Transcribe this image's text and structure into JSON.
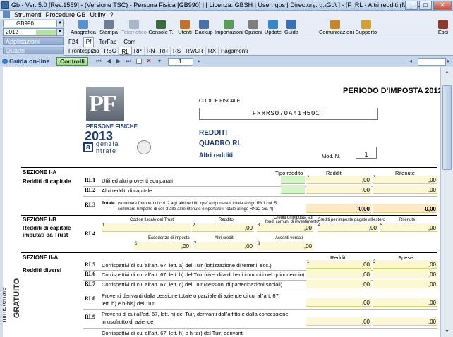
{
  "window": {
    "title": "Gb - Ver. 5.0 [Rev.1559] - (Versione TSC) - Persona Fisica [GB990]  | [ Licenza: GBSH | User: gbs | Directory: g:\\Gb\\ ] - [F_RL - Altri redditi (Mod.1)]",
    "minimize": "_",
    "maximize": "□",
    "close": "✕"
  },
  "menu": [
    "Strumenti",
    "Procedure GB",
    "Utility",
    "?"
  ],
  "left": {
    "module": "GB990",
    "year": "2012",
    "applicazioni": "Applicazioni",
    "quadri": "Quadri"
  },
  "toolbar": [
    {
      "label": "Anagrafica",
      "icon": "id-card-icon",
      "color": "#5a8fd0"
    },
    {
      "label": "Stampa",
      "icon": "printer-icon",
      "color": "#6c7d94"
    },
    {
      "label": "Telematico",
      "icon": "network-icon",
      "color": "#a9b6c8"
    },
    {
      "label": "Console T.",
      "icon": "console-icon",
      "color": "#3a6b3a"
    },
    {
      "label": "Utenti",
      "icon": "users-icon",
      "color": "#c0732f"
    },
    {
      "label": "Backup",
      "icon": "backup-icon",
      "color": "#4d6fa8"
    },
    {
      "label": "Importazioni",
      "icon": "import-icon",
      "color": "#5a9b58"
    },
    {
      "label": "Opzioni",
      "icon": "options-icon",
      "color": "#7e7e7e"
    },
    {
      "label": "Update",
      "icon": "update-icon",
      "color": "#3b87c4"
    },
    {
      "label": "Guida",
      "icon": "help-icon",
      "color": "#3c6fb5"
    },
    {
      "label": "Comunicazioni",
      "icon": "mail-icon",
      "color": "#c2872e"
    },
    {
      "label": "Supporto",
      "icon": "support-icon",
      "color": "#d0a03a"
    },
    {
      "label": "Esci",
      "icon": "exit-icon",
      "color": "#8b3a2f"
    }
  ],
  "tabs_top": [
    "F24",
    "Pf",
    "TerFab",
    "Com"
  ],
  "tabs_top_active": "Pf",
  "tabs_quadri": [
    "Frontespizio",
    "RBC",
    "RL",
    "RP",
    "RN",
    "RR",
    "RS",
    "RV/CR",
    "RX",
    "Pagamenti"
  ],
  "tabs_quadri_active": "RL",
  "navbar": {
    "guida": "Guida on-line",
    "controlli": "Controlli",
    "page": "1"
  },
  "form": {
    "logo_top": "PERSONE FISICHE",
    "logo_year": "2013",
    "logo_agency": "genzia",
    "logo_agency2": "ntrate",
    "periodo": "PERIODO D'IMPOSTA 2012",
    "cf_label": "CODICE FISCALE",
    "cf_value": "FRRRSO70A41H501T",
    "redditi": "REDDITI",
    "quadro": "QUADRO RL",
    "altri": "Altri redditi",
    "modn": "Mod. N.",
    "modn_value": "1",
    "side_text": "ministeriale",
    "side_text2": "GRATUITO",
    "sez1a": "SEZIONE I-A",
    "sez1a_sub": "Redditi di capitale",
    "col_tipo": "Tipo reddito",
    "col_redditi": "Redditi",
    "col_ritenute": "Ritenute",
    "rl1_code": "RL1",
    "rl1_desc": "Utili ed altri proventi equiparati",
    "rl2_code": "RL2",
    "rl2_desc": "Altri redditi di capitale",
    "rl3_code": "RL3",
    "rl3_desc_bold": "Totale",
    "rl3_desc": "(sommare l'importo di col. 2 agli altri redditi Irpef e riportare il totale al rigo RN1 col. 5;",
    "rl3_desc2": "sommare l'importo di col. 3 alle altre ritenute e riportare il totale al rigo RN32 col. 4)",
    "rl3_v1": "0,00",
    "rl3_v2": "0,00",
    "zero": ",00",
    "n1": "1",
    "n2": "2",
    "n3": "3",
    "n4": "4",
    "n5": "5",
    "n6": "6",
    "n7": "7",
    "n8": "8",
    "sez1b": "SEZIONE I-B",
    "sez1b_sub": "Redditi di capitale",
    "sez1b_sub2": "imputati da Trust",
    "rl4_code": "RL4",
    "rl4_h1": "Codice fiscale del Trust",
    "rl4_h2": "Reddito",
    "rl4_h3": "Crediti di imposta sui",
    "rl4_h3b": "fondi comuni di investimento",
    "rl4_h4": "Crediti per imposte pagate all'estero",
    "rl4_h5": "Ritenute",
    "rl4_h6": "Eccedenze di imposta",
    "rl4_h7": "Altri crediti",
    "rl4_h8": "Acconti versati",
    "sez2a": "SEZIONE II-A",
    "sez2a_sub": "Redditi diversi",
    "col_spese": "Spese",
    "rl5_code": "RL5",
    "rl5_desc": "Corrispettivi di cui all'art. 67, lett. a) del Tuir (lottizzazione di terreni, ecc.)",
    "rl6_code": "RL6",
    "rl6_desc": "Corrispettivi di cui all'art. 67, lett. b) del Tuir (rivendita di beni immobili nel quinquennio)",
    "rl7_code": "RL7",
    "rl7_desc": "Corrispettivi di cui all'art. 67, lett. c) del Tuir (cessioni di partecipazioni sociali)",
    "rl8_code": "RL8",
    "rl8_desc": "Proventi derivanti dalla cessione totale o parziale di aziende di cui all'art. 67,",
    "rl8_desc2": "lett. h) e h-bis) del Tuir",
    "rl9_code": "RL9",
    "rl9_desc": "Proventi di cui all'art. 67, lett. h) del Tuir, derivanti dall'affitto e dalla concessione",
    "rl9_desc2": "in usufrutto di aziende",
    "rl10_desc": "Corrispettivi di cui all'art. 67, lett. h) e h-ter) del Tuir, derivanti"
  }
}
